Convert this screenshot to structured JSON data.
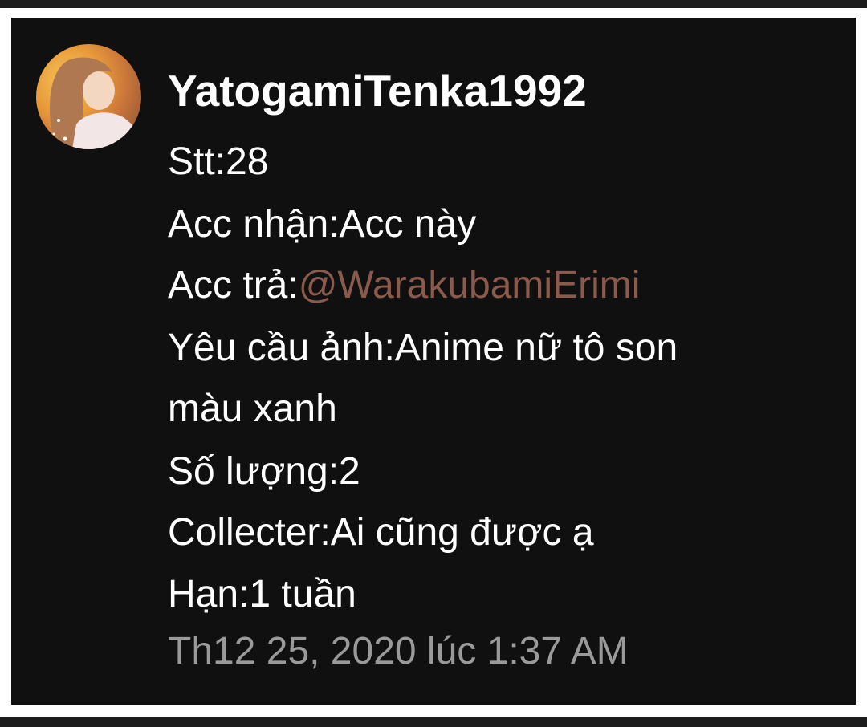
{
  "post": {
    "username": "YatogamiTenka1992",
    "lines": {
      "stt": "Stt:28",
      "acc_nhan": "Acc nhận:Acc này",
      "acc_tra_label": "Acc trả:",
      "acc_tra_mention": "@WarakubamiErimi",
      "yeu_cau_1": "Yêu cầu ảnh:Anime nữ tô son",
      "yeu_cau_2": "màu xanh",
      "so_luong": "Số lượng:2",
      "collecter": "Collecter:Ai cũng được ạ",
      "han": "Hạn:1 tuần"
    },
    "timestamp": "Th12 25, 2020 lúc 1:37 AM"
  },
  "colors": {
    "card_background": "#101010",
    "text": "#ffffff",
    "mention": "#8a5a4c",
    "timestamp": "#9a9a9a"
  }
}
